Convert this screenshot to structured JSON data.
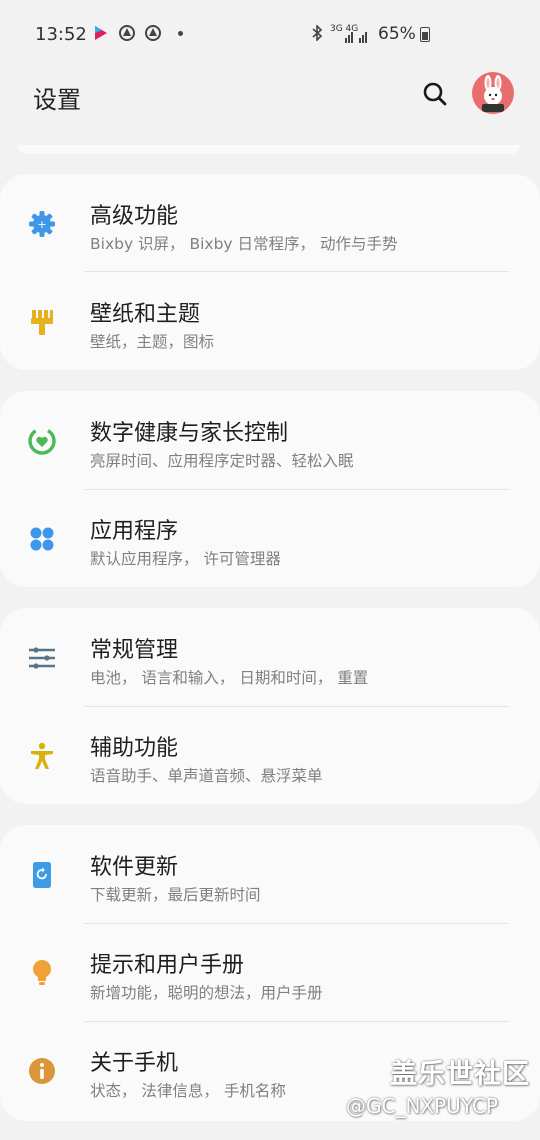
{
  "status_bar": {
    "time": "13:52",
    "network": "3G 4G",
    "battery": "65%"
  },
  "header": {
    "title": "设置"
  },
  "colors": {
    "gear": "#3e97e8",
    "theme": "#e3b21c",
    "wellbeing": "#4cb85a",
    "apps": "#3e97e8",
    "general": "#5a7487",
    "accessibility": "#d9b10f",
    "update": "#3e9be5",
    "tips": "#f0a23a",
    "about": "#d9963a"
  },
  "groups": [
    {
      "items": [
        {
          "icon": "gear-icon",
          "title": "高级功能",
          "subtitle": "Bixby 识屏， Bixby 日常程序， 动作与手势"
        },
        {
          "icon": "paintbrush-icon",
          "title": "壁纸和主题",
          "subtitle": "壁纸，主题，图标"
        }
      ]
    },
    {
      "items": [
        {
          "icon": "wellbeing-icon",
          "title": "数字健康与家长控制",
          "subtitle": "亮屏时间、应用程序定时器、轻松入眠"
        },
        {
          "icon": "apps-icon",
          "title": "应用程序",
          "subtitle": "默认应用程序， 许可管理器"
        }
      ]
    },
    {
      "items": [
        {
          "icon": "sliders-icon",
          "title": "常规管理",
          "subtitle": "电池， 语言和输入， 日期和时间， 重置"
        },
        {
          "icon": "accessibility-icon",
          "title": "辅助功能",
          "subtitle": "语音助手、单声道音频、悬浮菜单"
        }
      ]
    },
    {
      "items": [
        {
          "icon": "software-update-icon",
          "title": "软件更新",
          "subtitle": "下载更新，最后更新时间"
        },
        {
          "icon": "lightbulb-icon",
          "title": "提示和用户手册",
          "subtitle": "新增功能，聪明的想法，用户手册"
        },
        {
          "icon": "info-icon",
          "title": "关于手机",
          "subtitle": "状态， 法律信息， 手机名称"
        }
      ]
    }
  ],
  "watermark": {
    "line1": "盖乐世社区",
    "line2": "@GC_NXPUYCP"
  }
}
